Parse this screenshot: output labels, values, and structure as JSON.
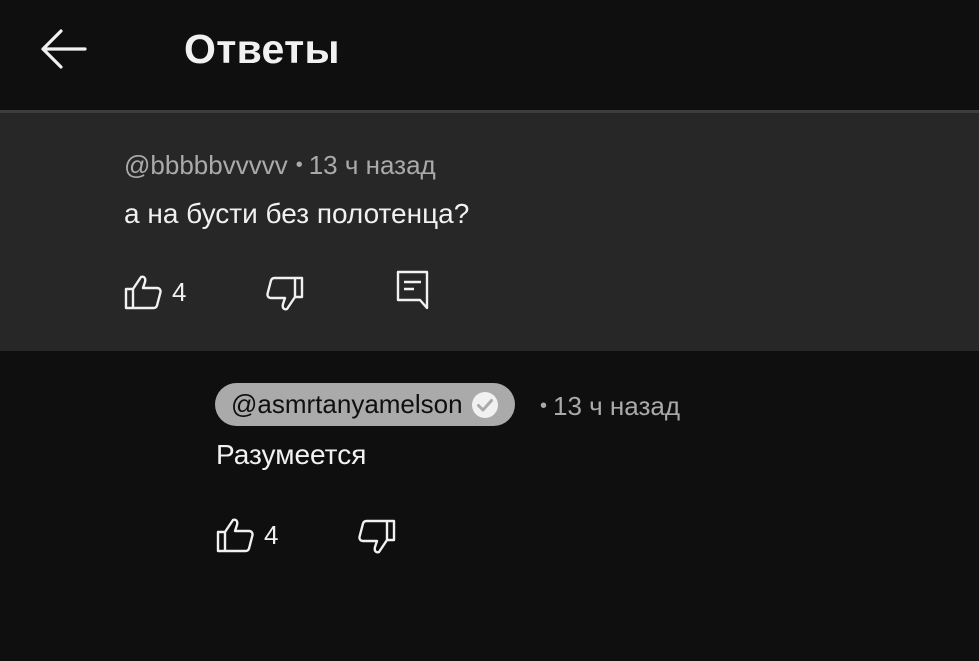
{
  "header": {
    "title": "Ответы",
    "back_icon": "arrow-left-icon"
  },
  "parent_comment": {
    "author": "@bbbbbvvvvv",
    "separator": "•",
    "time": "13 ч назад",
    "text": "а на бусти без полотенца?",
    "likes": "4",
    "icons": [
      "thumb-up-icon",
      "thumb-down-icon",
      "reply-icon"
    ]
  },
  "reply": {
    "author": "@asmrtanyamelson",
    "verified": true,
    "separator": "•",
    "time": "13 ч назад",
    "text": "Разумеется",
    "likes": "4",
    "icons": [
      "thumb-up-icon",
      "thumb-down-icon",
      "verified-check-icon"
    ]
  },
  "colors": {
    "background": "#0f0f0f",
    "parent_background": "#272727",
    "text_primary": "#f1f1f1",
    "text_secondary": "#aaaaaa",
    "author_chip": "#aaaaaa"
  }
}
